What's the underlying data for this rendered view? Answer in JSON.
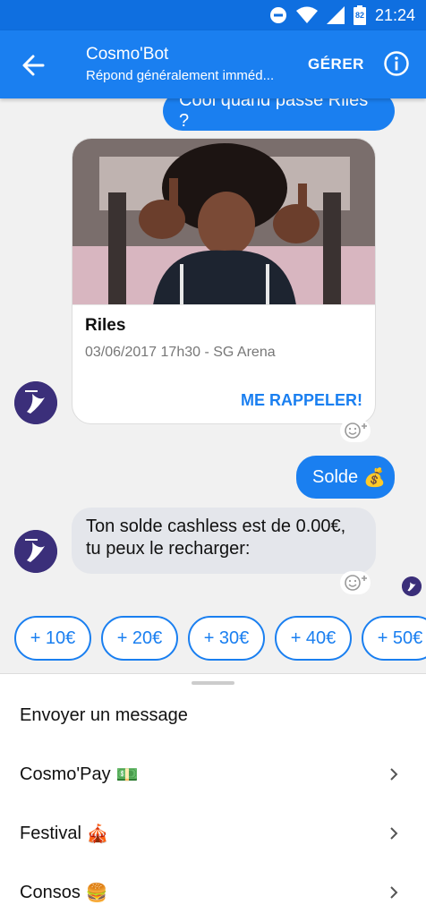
{
  "status_bar": {
    "time": "21:24",
    "battery_level": "82"
  },
  "header": {
    "title": "Cosmo'Bot",
    "subtitle": "Répond généralement imméd...",
    "manage_label": "GÉRER"
  },
  "chat": {
    "msg_out_1": "Cool quand passe Riles ?",
    "card": {
      "title": "Riles",
      "subtitle": "03/06/2017 17h30 - SG Arena",
      "action_label": "ME RAPPELER!"
    },
    "msg_out_2_text": "Solde",
    "msg_out_2_emoji": "💰",
    "msg_in_line1": "Ton solde cashless est de 0.00€,",
    "msg_in_line2": "tu peux le recharger:"
  },
  "quick_replies": [
    "+ 10€",
    "+ 20€",
    "+ 30€",
    "+ 40€",
    "+ 50€"
  ],
  "menu": {
    "composer_label": "Envoyer un message",
    "items": [
      {
        "label": "Cosmo'Pay",
        "emoji": "💵"
      },
      {
        "label": "Festival",
        "emoji": "🎪"
      },
      {
        "label": "Consos",
        "emoji": "🍔"
      }
    ]
  },
  "colors": {
    "primary": "#1a7ff0",
    "status_bar": "#0f6fe0",
    "bubble_in": "#e4e6eb"
  }
}
